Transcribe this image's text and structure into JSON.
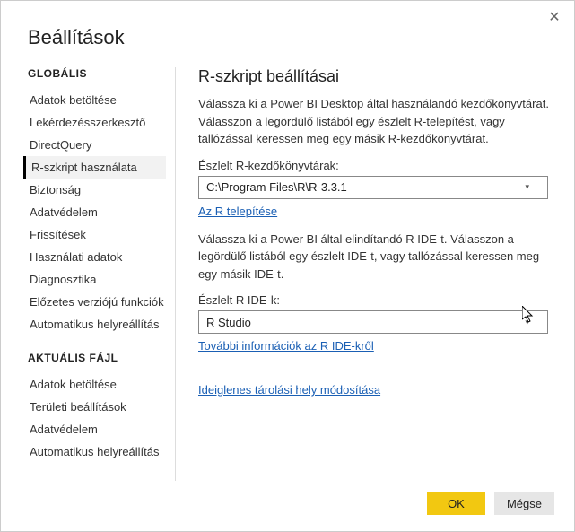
{
  "dialog": {
    "title": "Beállítások",
    "close_symbol": "✕"
  },
  "sidebar": {
    "section_global": "GLOBÁLIS",
    "section_current": "AKTUÁLIS FÁJL",
    "global_items": [
      "Adatok betöltése",
      "Lekérdezésszerkesztő",
      "DirectQuery",
      "R-szkript használata",
      "Biztonság",
      "Adatvédelem",
      "Frissítések",
      "Használati adatok",
      "Diagnosztika",
      "Előzetes verziójú funkciók",
      "Automatikus helyreállítás"
    ],
    "current_items": [
      "Adatok betöltése",
      "Területi beállítások",
      "Adatvédelem",
      "Automatikus helyreállítás"
    ],
    "selected_index": 3
  },
  "panel": {
    "title": "R-szkript beállításai",
    "desc1": "Válassza ki a Power BI Desktop által használandó kezdőkönyvtárat. Válasszon a legördülő listából egy észlelt R-telepítést, vagy tallózással keressen meg egy másik R-kezdőkönyvtárat.",
    "label_rhome": "Észlelt R-kezdőkönyvtárak:",
    "rhome_value": "C:\\Program Files\\R\\R-3.3.1",
    "link_install_r": "Az R telepítése",
    "desc2": "Válassza ki a Power BI által elindítandó R IDE-t. Válasszon a legördülő listából egy észlelt IDE-t, vagy tallózással keressen meg egy másik IDE-t.",
    "label_ride": "Észlelt R IDE-k:",
    "ride_value": "R Studio",
    "link_ide_info": "További információk az R IDE-kről",
    "link_temp": "Ideiglenes tárolási hely módosítása"
  },
  "buttons": {
    "ok": "OK",
    "cancel": "Mégse"
  }
}
